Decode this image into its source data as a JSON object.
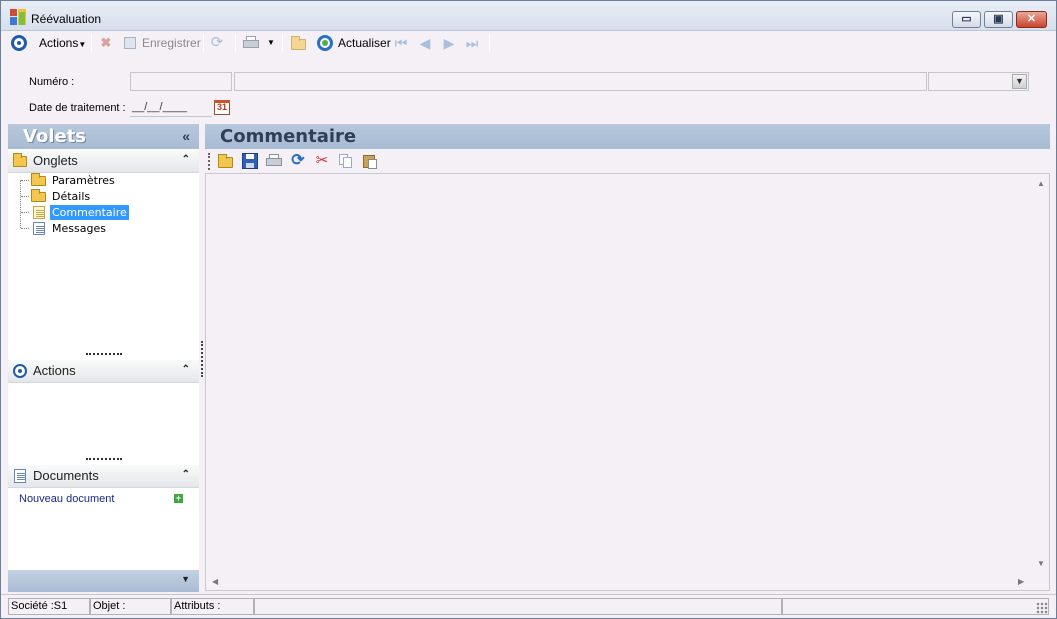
{
  "window": {
    "title": "Réévaluation",
    "minimize_glyph": "▭",
    "maximize_glyph": "▣",
    "close_glyph": "✕"
  },
  "toolbar": {
    "actions_label": "Actions",
    "save_label": "Enregistrer",
    "refresh_label": "Actualiser"
  },
  "form": {
    "numero_label": "Numéro :",
    "numero_value": "",
    "numero_description": "",
    "numero_option": "",
    "date_label": "Date de traitement :",
    "date_value": "__/__/____",
    "calendar_day": "31"
  },
  "left_pane": {
    "title": "Volets",
    "collapse_glyph": "«",
    "onglets": {
      "title": "Onglets",
      "items": [
        {
          "label": "Paramètres",
          "icon": "folder-icon"
        },
        {
          "label": "Détails",
          "icon": "folder-icon"
        },
        {
          "label": "Commentaire",
          "icon": "note-icon",
          "selected": true
        },
        {
          "label": "Messages",
          "icon": "document-icon"
        }
      ]
    },
    "actions": {
      "title": "Actions"
    },
    "documents": {
      "title": "Documents",
      "new_document_label": "Nouveau document"
    }
  },
  "right_pane": {
    "title": "Commentaire",
    "comment_text": ""
  },
  "statusbar": {
    "societe": "Société :S1",
    "objet": "Objet :",
    "attributs": "Attributs :"
  },
  "colors": {
    "pane_header": "#a7bbd3",
    "selection": "#3399ff",
    "accent_ring": "#1f5ba8"
  }
}
